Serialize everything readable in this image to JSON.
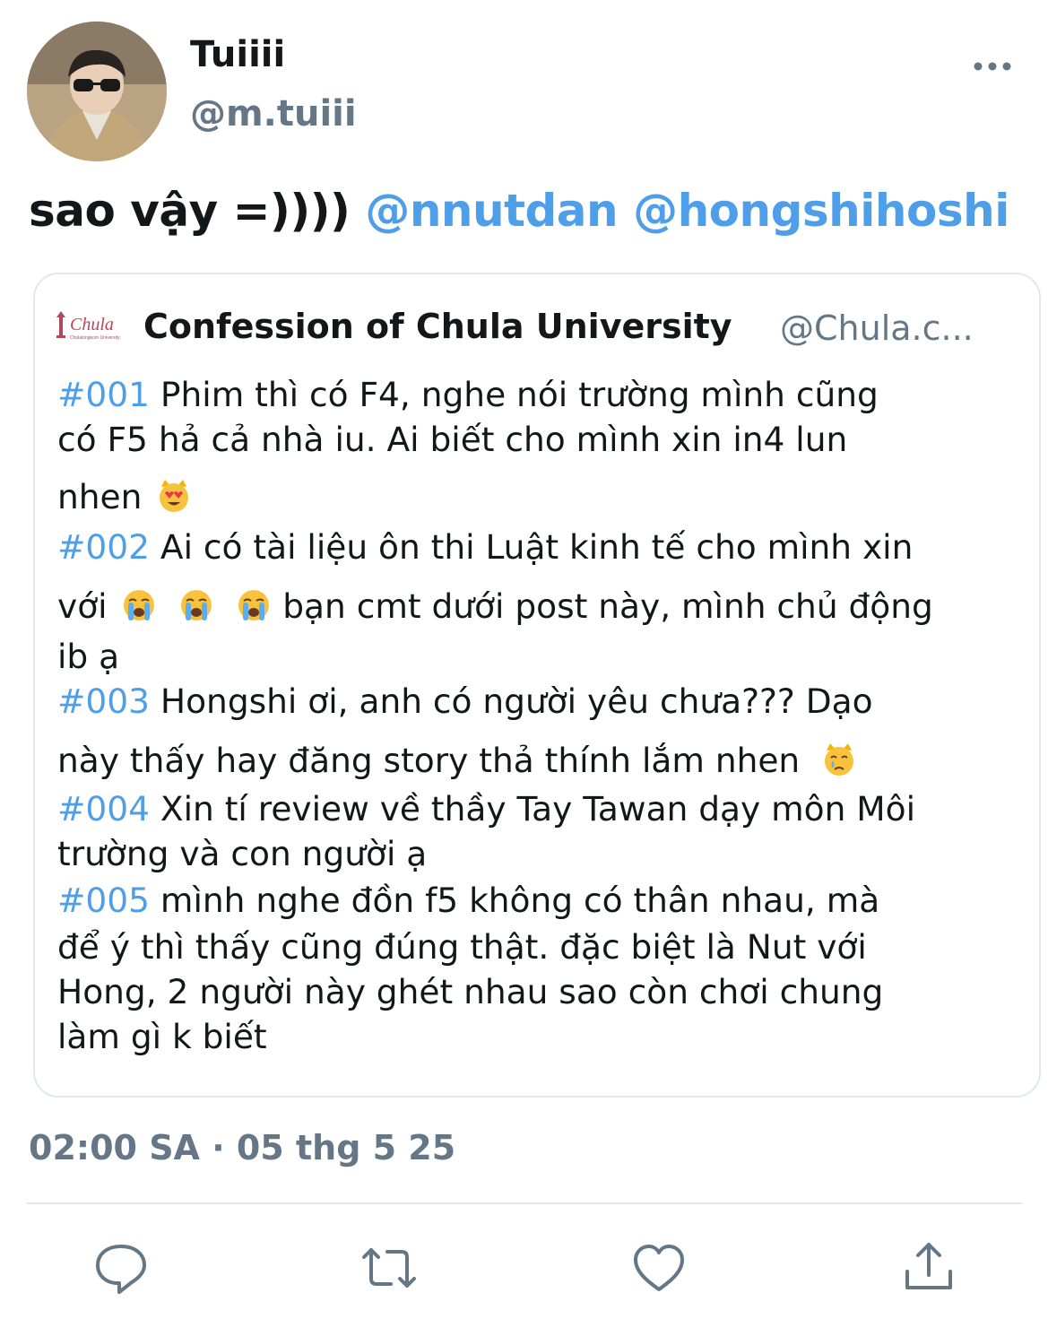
{
  "tweet": {
    "display_name": "Tuiiii",
    "handle": "@m.tuiii",
    "text_prefix": "sao vậy =)))) ",
    "mentions": [
      "@nnutdan",
      "@hongshihoshi"
    ],
    "timestamp": "02:00 SA · 05 thg 5 25"
  },
  "quote": {
    "logo_text": "Chula",
    "logo_subtext": "Chulalongkorn University",
    "name": "Confession of Chula University",
    "handle": "@Chula.c...",
    "posts": [
      {
        "tag": "#001",
        "lines": [
          " Phim thì có F4, nghe nói trường mình cũng",
          "có F5 hả cả nhà iu. Ai biết cho mình xin in4 lun",
          "nhen"
        ]
      },
      {
        "tag": "#002",
        "lines": [
          " Ai có tài liệu ôn thi Luật kinh tế cho mình xin",
          "với",
          "  bạn cmt dưới post này, mình chủ động",
          "ib ạ"
        ]
      },
      {
        "tag": "#003",
        "lines": [
          " Hongshi ơi, anh có người yêu chưa??? Dạo",
          "này thấy hay đăng story thả thính lắm nhen"
        ]
      },
      {
        "tag": "#004",
        "lines": [
          " Xin tí review về thầy Tay Tawan dạy môn Môi",
          "trường và con người ạ"
        ]
      },
      {
        "tag": "#005",
        "lines": [
          " mình nghe đồn f5 không có thân nhau, mà",
          "để ý thì thấy cũng đúng thật. đặc biệt là Nut với",
          "Hong, 2 người này ghét nhau sao còn chơi chung",
          "làm gì k biết"
        ]
      }
    ],
    "emojis": [
      "heart-eyes-cat",
      "loudly-crying-face",
      "loudly-crying-face",
      "loudly-crying-face",
      "crying-cat-face"
    ]
  },
  "actions": [
    "reply-icon",
    "retweet-icon",
    "like-icon",
    "share-icon"
  ],
  "colors": {
    "mention": "#4f9ee8",
    "secondary": "#657786",
    "text": "#14171a",
    "border": "#e1e8ed"
  }
}
